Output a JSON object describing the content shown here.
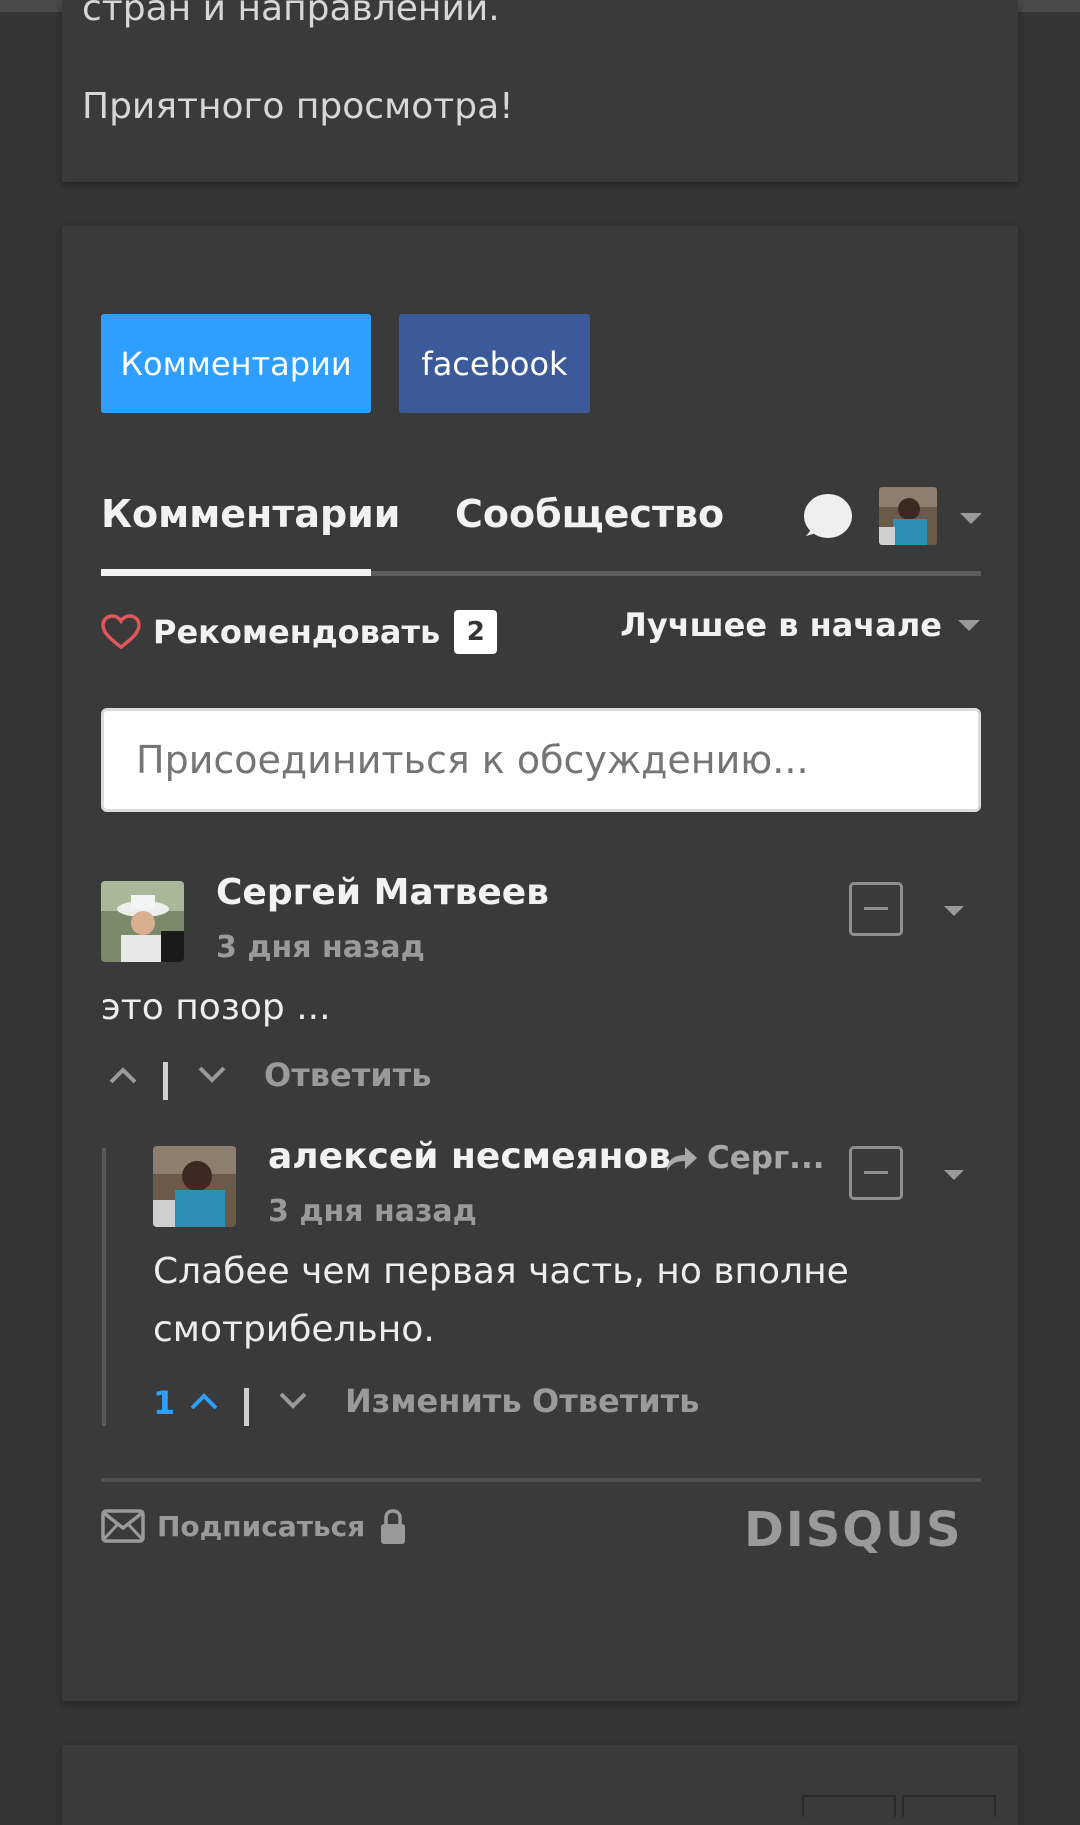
{
  "description": {
    "line1": "стран и направлений.",
    "line2": "Приятного просмотра!"
  },
  "tabs_buttons": {
    "comments": "Комментарии",
    "facebook": "facebook"
  },
  "disqus": {
    "tab_comments": "Комментарии",
    "tab_community": "Сообщество",
    "recommend_label": "Рекомендовать",
    "recommend_count": "2",
    "sort_label": "Лучшее в начале",
    "join_placeholder": "Присоединиться к обсуждению...",
    "subscribe_label": "Подписаться",
    "logo": "DISQUS"
  },
  "comments": [
    {
      "author": "Сергей Матвеев",
      "time": "3 дня назад",
      "text": "это позор ...",
      "reply_label": "Ответить"
    },
    {
      "author": "алексей несмеянов",
      "reply_to": "Серг...",
      "time": "3 дня назад",
      "text": "Слабее чем первая часть, но вполне смотрибельно.",
      "votes": "1",
      "edit_label": "Изменить",
      "reply_label": "Ответить"
    }
  ],
  "colors": {
    "background": "#353535",
    "card": "#3a3a3a",
    "accent_blue": "#2e9fff",
    "facebook_blue": "#3c5a99",
    "heart_red": "#e0565b"
  },
  "icons": [
    "chat-bubble-icon",
    "heart-icon",
    "upvote-icon",
    "downvote-icon",
    "reply-arrow-icon",
    "mail-icon",
    "lock-icon",
    "minimize-icon",
    "chevron-down-icon"
  ]
}
